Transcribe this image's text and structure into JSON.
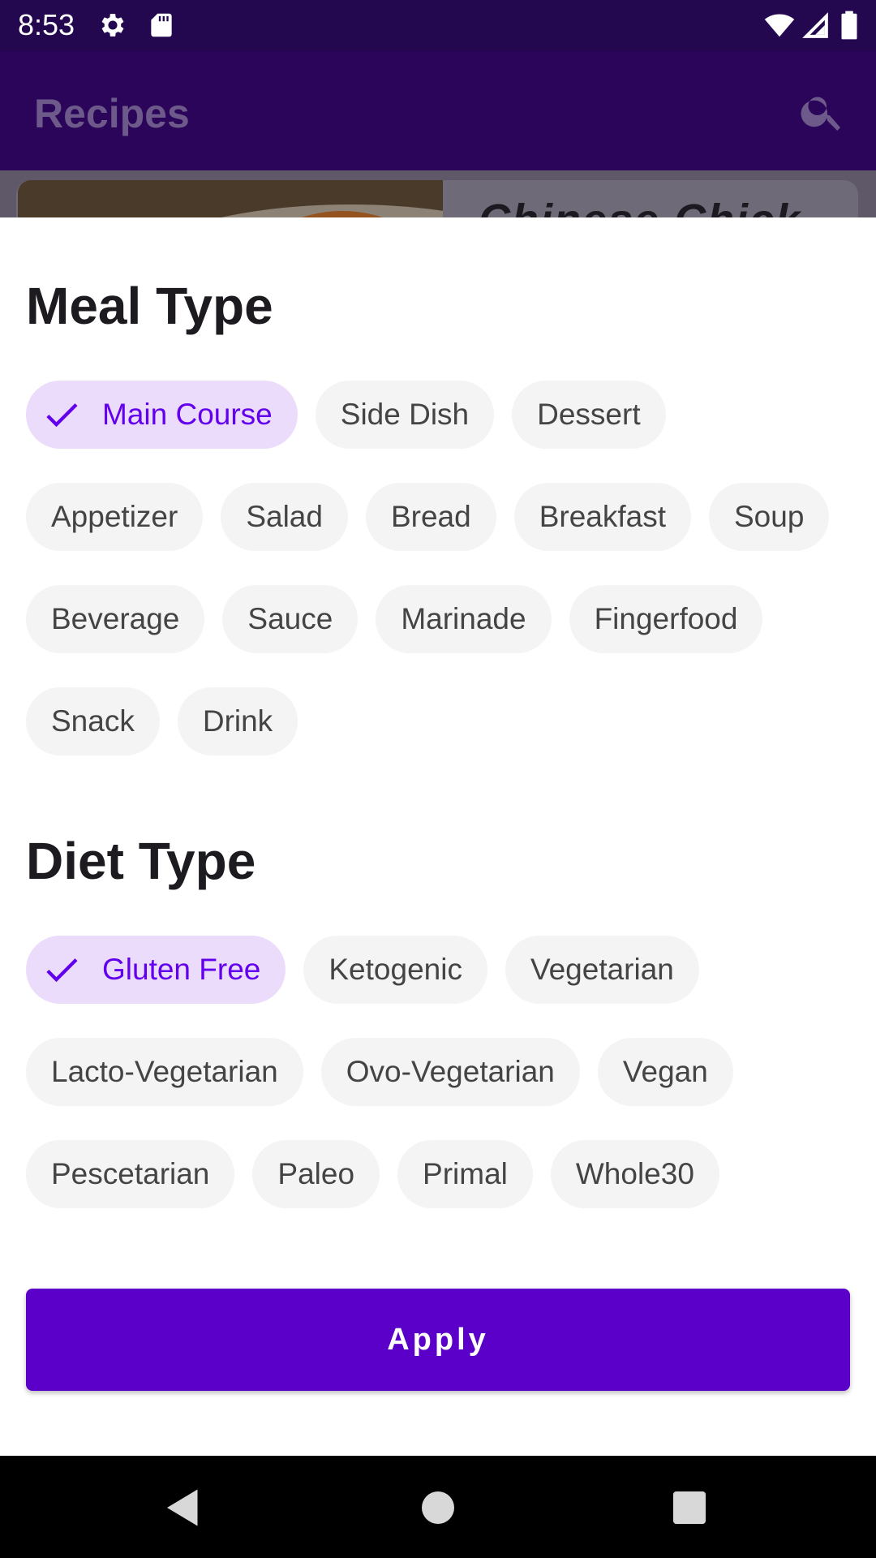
{
  "status_bar": {
    "time": "8:53",
    "icons": [
      "gear-icon",
      "sd-card-icon",
      "wifi-icon",
      "cell-signal-icon",
      "battery-icon"
    ]
  },
  "app_bar": {
    "title": "Recipes",
    "search_icon": "search-icon"
  },
  "background_card": {
    "title_fragment": "Chinese Chick"
  },
  "meal_type": {
    "title": "Meal Type",
    "chips": [
      {
        "label": "Main Course",
        "selected": true
      },
      {
        "label": "Side Dish",
        "selected": false
      },
      {
        "label": "Dessert",
        "selected": false
      },
      {
        "label": "Appetizer",
        "selected": false
      },
      {
        "label": "Salad",
        "selected": false
      },
      {
        "label": "Bread",
        "selected": false
      },
      {
        "label": "Breakfast",
        "selected": false
      },
      {
        "label": "Soup",
        "selected": false
      },
      {
        "label": "Beverage",
        "selected": false
      },
      {
        "label": "Sauce",
        "selected": false
      },
      {
        "label": "Marinade",
        "selected": false
      },
      {
        "label": "Fingerfood",
        "selected": false
      },
      {
        "label": "Snack",
        "selected": false
      },
      {
        "label": "Drink",
        "selected": false
      }
    ]
  },
  "diet_type": {
    "title": "Diet Type",
    "chips": [
      {
        "label": "Gluten Free",
        "selected": true
      },
      {
        "label": "Ketogenic",
        "selected": false
      },
      {
        "label": "Vegetarian",
        "selected": false
      },
      {
        "label": "Lacto-Vegetarian",
        "selected": false
      },
      {
        "label": "Ovo-Vegetarian",
        "selected": false
      },
      {
        "label": "Vegan",
        "selected": false
      },
      {
        "label": "Pescetarian",
        "selected": false
      },
      {
        "label": "Paleo",
        "selected": false
      },
      {
        "label": "Primal",
        "selected": false
      },
      {
        "label": "Whole30",
        "selected": false
      }
    ]
  },
  "apply_label": "Apply",
  "colors": {
    "accent": "#6200ee",
    "apply_button": "#5a00c8",
    "selected_chip_bg": "#ecdcfb",
    "app_bar": "#2b0559"
  },
  "nav_bar": {
    "icons": [
      "back-icon",
      "home-icon",
      "recents-icon"
    ]
  }
}
